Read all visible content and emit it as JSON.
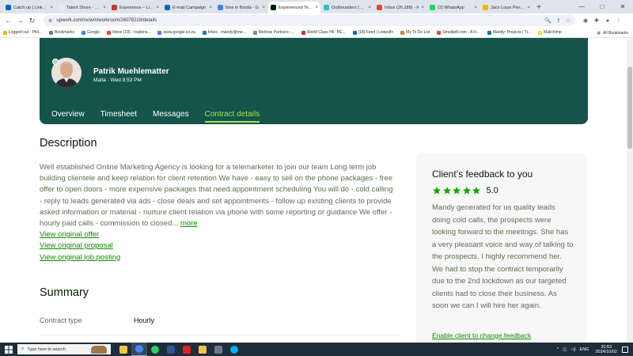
{
  "browser": {
    "tabs": [
      {
        "label": "Catch up | LinkedIn",
        "color": "#0a66c2",
        "active": false
      },
      {
        "label": "Talent Shore - Em...",
        "color": "#e8eaed",
        "active": false
      },
      {
        "label": "Experience – Livin...",
        "color": "#c0392b",
        "active": false
      },
      {
        "label": "E-mail Campaign",
        "color": "#0a66c2",
        "active": false
      },
      {
        "label": "time in florida - G",
        "color": "#4285f4",
        "active": false
      },
      {
        "label": "Experienced Tele...",
        "color": "#001e00",
        "active": true
      },
      {
        "label": "Outbounders | M...",
        "color": "#20c6b7",
        "active": false
      },
      {
        "label": "Inbox (26,188) - h",
        "color": "#ea4335",
        "active": false
      },
      {
        "label": "(2) WhatsApp",
        "color": "#25d366",
        "active": false
      },
      {
        "label": "Jaco Louw Pension",
        "color": "#f4b400",
        "active": false
      }
    ],
    "new_tab": "+",
    "window_controls": {
      "minimize": "—",
      "maximize": "□",
      "close": "✕"
    },
    "url": "upwork.com/nx/wm/workroom/26078219/details",
    "nav": {
      "back": "←",
      "forward": "→",
      "reload": "↻"
    },
    "bookmarks": [
      {
        "label": "Logged out - Phil...",
        "color": "#f4b400"
      },
      {
        "label": "Bookmarks",
        "color": "#777777"
      },
      {
        "label": "Google",
        "color": "#4285f4"
      },
      {
        "label": "Inbox (19) - hopkins...",
        "color": "#ea4335"
      },
      {
        "label": "www.google.co.za",
        "color": "#4285f4"
      },
      {
        "label": "Inbox - mandy@me...",
        "color": "#0078d4"
      },
      {
        "label": "Melrose Partners -...",
        "color": "#888888"
      },
      {
        "label": "World Class HF: PE...",
        "color": "#c0392b"
      },
      {
        "label": "(18) Feed | LinkedIn",
        "color": "#0a66c2"
      },
      {
        "label": "My To Do List",
        "color": "#e67e22"
      },
      {
        "label": "Smallpdf.com - A Fr...",
        "color": "#e74c3c"
      },
      {
        "label": "Mandy: Projects | Tr...",
        "color": "#0079bf"
      },
      {
        "label": "Mailchimp",
        "color": "#ffe01b"
      }
    ],
    "all_bookmarks": "All Bookmarks"
  },
  "header": {
    "freelancer_name": "Patrik Muehlematter",
    "freelancer_meta": "Malta · Wed 8:53 PM",
    "tabs": [
      {
        "label": "Overview",
        "active": false
      },
      {
        "label": "Timesheet",
        "active": false
      },
      {
        "label": "Messages",
        "active": false
      },
      {
        "label": "Contract details",
        "active": true
      }
    ]
  },
  "description": {
    "title": "Description",
    "text": "Well established Online Marketing Agency is looking for a telemarketer to join our team Long term job building clientele and keep relation for client retention We have - easy to sell on the phone packages - free offer to open doors - more expensive packages that need appointment scheduling You will do - cold calling - reply to leads generated via ads - close deals and set appointments - follow up existing clients to provide asked information or material - nurture client relation via phone with some reporting or guidance We offer - hourly paid calls - commission to closed...",
    "more_label": "more",
    "links": [
      "View original offer",
      "View original proposal",
      "View original job posting"
    ]
  },
  "summary": {
    "title": "Summary",
    "contract_type_label": "Contract type",
    "contract_type_value": "Hourly"
  },
  "feedback": {
    "title": "Client’s feedback to you",
    "stars": 5,
    "score": "5.0",
    "text": "Mandy generated for us quality leads doing cold calls, the prospects were looking forward to the meetings. She has a very pleasant voice and way of talking to the prospects. I highly recommend her. We had to stop the contract temporarily due to the 2nd lockdown as our targeted clients had to close their business. As soon we can I will hire her again.",
    "link": "Enable client to change feedback"
  },
  "taskbar": {
    "search_placeholder": "Type here to search",
    "apps": [
      {
        "name": "file-explorer",
        "color": "#f4c542"
      },
      {
        "name": "chrome",
        "color": "#4285f4"
      },
      {
        "name": "whatsapp",
        "color": "#25d366"
      },
      {
        "name": "word",
        "color": "#2b579a"
      },
      {
        "name": "acrobat",
        "color": "#e02020"
      },
      {
        "name": "folder",
        "color": "#f4c542"
      },
      {
        "name": "calculator",
        "color": "#6b7b8c"
      },
      {
        "name": "skype",
        "color": "#00aff0"
      }
    ],
    "language": "ENG",
    "time": "20:53",
    "date": "2024/10/02"
  },
  "colors": {
    "brand_dark": "#14544a",
    "accent_green": "#108a00",
    "tab_active": "#a5e44d",
    "star": "#14a800"
  }
}
